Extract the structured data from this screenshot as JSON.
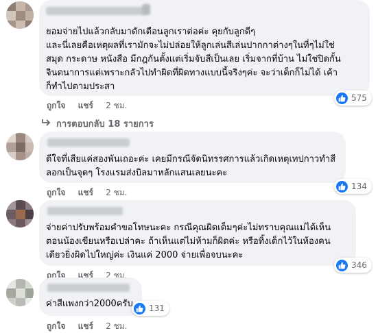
{
  "comments": [
    {
      "text": "ยอมจ่ายไปแล้วกลับมาดักเตือนลูกเราต่อค่ะ คุยกับลูกดีๆ\nและนี่เลยคือเหตุผลที่เรามักจะไม่ปล่อยให้ลูกเล่นสีเล่นปากกาต่างๆในที่ๆไม่ใช่\nสมุด กระดาษ หนังสือ มีกฎกันตั้งแต่เริ่มจับสีเป็นเลย เริ่มจากที่บ้าน ไม่ใช่ปิดกั้น\nจินตนาการแต่เพราะกลัวไปทำผิดที่ผิดทางแบบนี้จริงๆค่ะ จะว่าเด็กก็ไม่ได้ เค้า\nก็ทำไปตามประสา",
      "like": "ถูกใจ",
      "reply": "แชร์",
      "time": "2 ชม.",
      "reactions": "575",
      "replies_label": "การตอบกลับ 18 รายการ"
    },
    {
      "text": "ดีใจที่เสียแค่สองพันเถอะค่ะ เคยมีกรณีจัดนิทรรศการแล้วเกิดเหตุเทปกาวทำสี\nลอกเป็นจุดๆ โรงแรมส่งบิลมาหลักแสนเลยนะคะ",
      "like": "ถูกใจ",
      "reply": "แชร์",
      "time": "2 ชม.",
      "reactions": "134"
    },
    {
      "text": "จ่ายค่าปรับพร้อมคำขอโทษนะคะ กรณีคุณผิดเต็มๆค่ะไม่ทราบคุณแม่ได้เห็น\nตอนน้องเขียนหรือเปล่าคะ ถ้าเห็นแต่ไม่ห้ามก็ผิดค่ะ หรือทิ้งเด็กไว้ในห้องคน\nเดียวยิ่งผิดไปใหญ่ค่ะ เงินแค่ 2000 จ่ายเพื่อจบนะคะ",
      "like": "ถูกใจ",
      "reply": "แชร์",
      "time": "2 ชม.",
      "reactions": "346"
    },
    {
      "text": "ค่าสีแพงกว่า2000ครับ",
      "like": "ถูกใจ",
      "reply": "แชร์",
      "time": "2 ชม.",
      "reactions": "131"
    }
  ],
  "colors": {
    "bubble": "#f0f2f5",
    "like_blue": "#1877f2",
    "secondary_text": "#65676b"
  },
  "icons": {
    "reaction": "thumbs-up-icon",
    "reply_arrow": "reply-arrow-icon"
  }
}
